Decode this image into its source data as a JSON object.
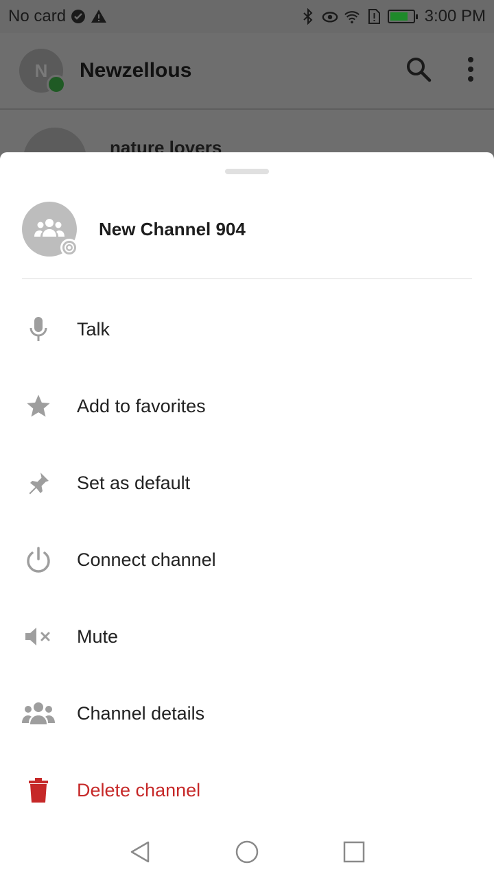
{
  "status_bar": {
    "carrier": "No card",
    "time": "3:00 PM",
    "battery_color": "#1e8a2a",
    "icons": [
      "check-circle-icon",
      "warning-icon",
      "bluetooth-icon",
      "eye-icon",
      "wifi-icon",
      "sim-alert-icon",
      "battery-icon"
    ]
  },
  "app_bar": {
    "avatar_initial": "N",
    "title": "Newzellous",
    "presence_color": "#1f5a24"
  },
  "background_list": {
    "first_item_title": "nature lovers"
  },
  "sheet": {
    "channel_name": "New Channel 904",
    "menu": [
      {
        "label": "Talk",
        "icon": "microphone-icon"
      },
      {
        "label": "Add to favorites",
        "icon": "star-icon"
      },
      {
        "label": "Set as default",
        "icon": "pin-icon"
      },
      {
        "label": "Connect channel",
        "icon": "power-icon"
      },
      {
        "label": "Mute",
        "icon": "volume-mute-icon"
      },
      {
        "label": "Channel details",
        "icon": "group-icon"
      },
      {
        "label": "Delete channel",
        "icon": "trash-icon",
        "color": "#c62828"
      }
    ]
  },
  "nav_bar": {
    "buttons": [
      "back-icon",
      "home-icon",
      "recents-icon"
    ]
  }
}
